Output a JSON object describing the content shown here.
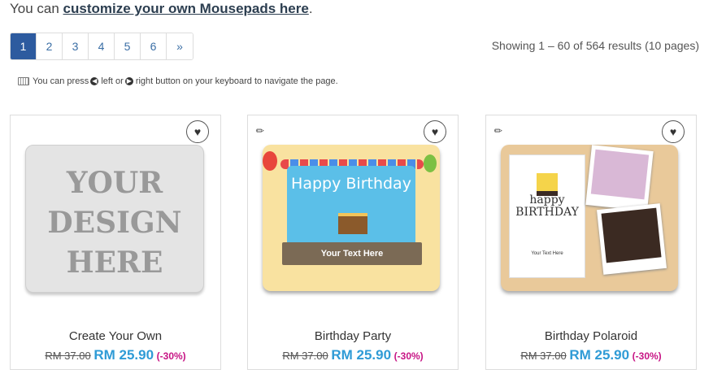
{
  "intro": {
    "prefix": "You can ",
    "link": "customize your own Mousepads here",
    "suffix": "."
  },
  "pagination": {
    "pages": [
      "1",
      "2",
      "3",
      "4",
      "5",
      "6",
      "»"
    ],
    "active": "1"
  },
  "showing": "Showing 1 – 60 of 564 results (10 pages)",
  "hint": {
    "a": "You can press ",
    "b": " left or ",
    "c": " right button on your keyboard to navigate the page."
  },
  "products": [
    {
      "name": "Create Your Own",
      "old_price": "RM 37.00",
      "new_price": "RM 25.90",
      "discount": "(-30%)",
      "image_text": "YOUR DESIGN HERE"
    },
    {
      "name": "Birthday Party",
      "old_price": "RM 37.00",
      "new_price": "RM 25.90",
      "discount": "(-30%)",
      "image_title": "Happy Birthday",
      "image_banner": "Your Text Here"
    },
    {
      "name": "Birthday Polaroid",
      "old_price": "RM 37.00",
      "new_price": "RM 25.90",
      "discount": "(-30%)",
      "image_title": "happy BIRTHDAY",
      "image_sub": "Your Text Here"
    }
  ],
  "colors": {
    "accent": "#2d5b9f",
    "price": "#2f9bd6",
    "discount": "#c71585"
  }
}
